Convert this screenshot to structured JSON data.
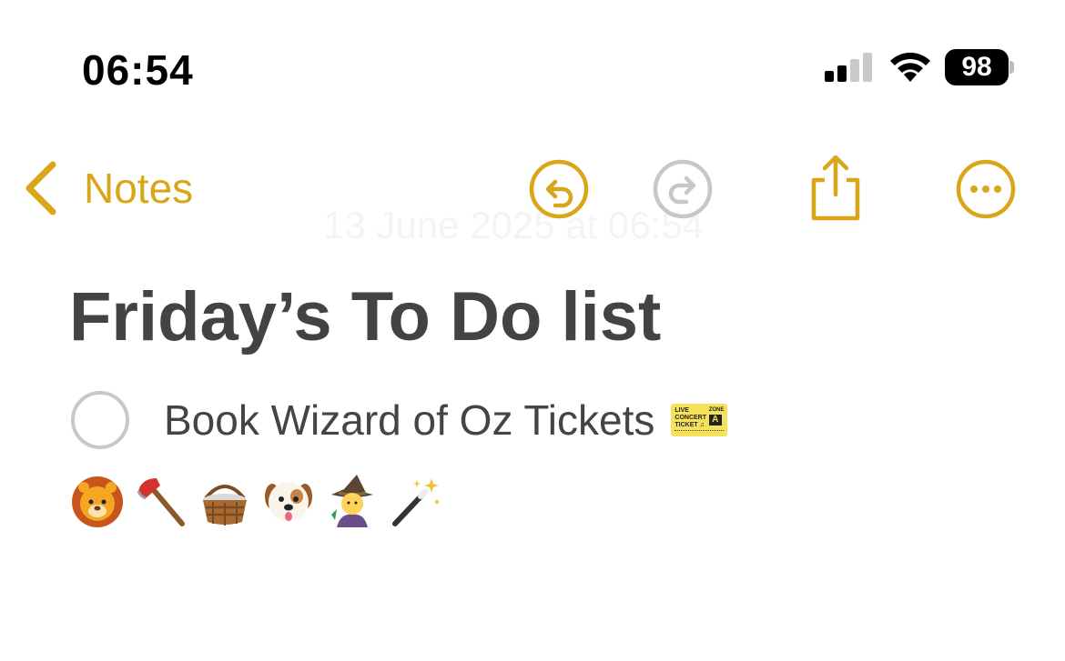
{
  "status_bar": {
    "time": "06:54",
    "battery": "98"
  },
  "nav": {
    "back_label": "Notes",
    "icons": [
      "chevron-left-icon",
      "undo-icon",
      "redo-icon",
      "share-icon",
      "more-icon"
    ],
    "accent_color": "#d9a61a",
    "disabled_color": "#c7c7c7"
  },
  "note": {
    "ghost_date": "13 June 2025 at 06:54",
    "title": "Friday’s To Do list",
    "checklist": [
      {
        "text": "Book Wizard of Oz Tickets",
        "checked": false,
        "trailing_emoji": "ticket"
      }
    ],
    "ticket_emoji": {
      "line1": "LIVE",
      "line2": "CONCERT",
      "line3": "TICKET ♫",
      "zone": "ZONE",
      "zone_letter": "A"
    },
    "emoji_line": [
      "lion",
      "axe",
      "basket",
      "dog",
      "witch",
      "magic-wand"
    ]
  }
}
